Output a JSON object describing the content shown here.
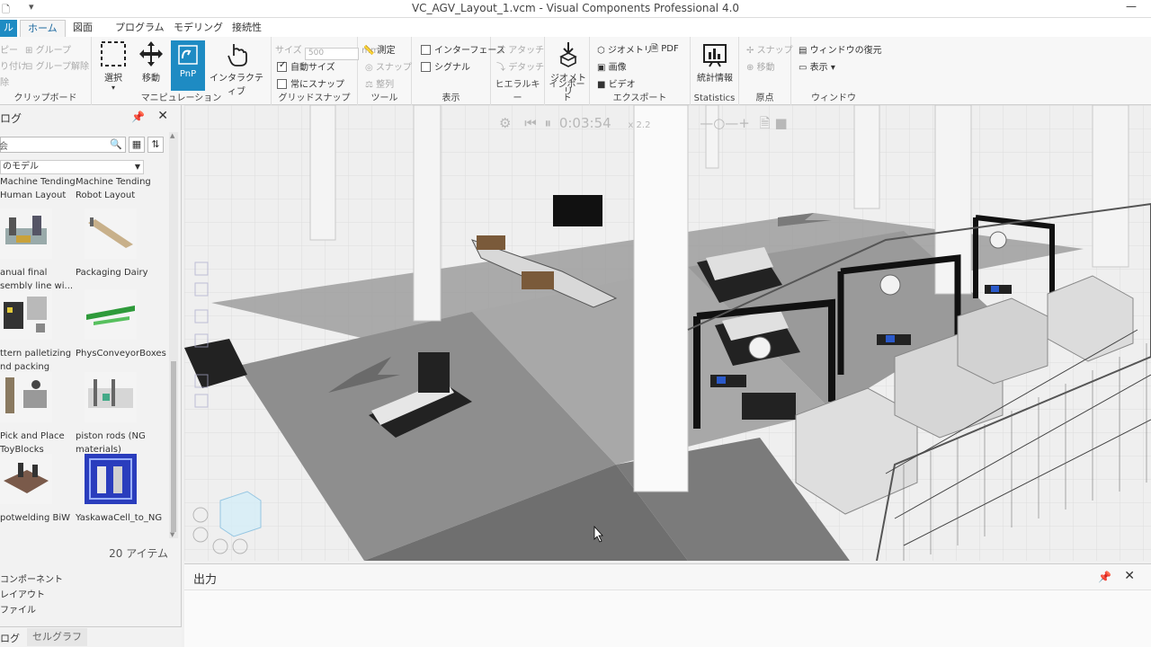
{
  "window": {
    "title": "VC_AGV_Layout_1.vcm - Visual Components Professional 4.0",
    "qa_icon": "file-icon",
    "qa_arrow": "▾",
    "minimize": "—"
  },
  "tabs": {
    "file": "ル",
    "home": "ホーム",
    "drawing": "図面",
    "program": "プログラム",
    "modeling": "モデリング",
    "connectivity": "接続性"
  },
  "ribbon": {
    "clipboard": {
      "label": "クリップボード",
      "items": [
        "ピー",
        "り付け",
        "除"
      ],
      "group": "グループ",
      "ungroup": "グループ解除"
    },
    "manipulation": {
      "label": "マニピュレーション",
      "select": "選択",
      "move": "移動",
      "pnp": "PnP",
      "interactive": "インタラクティブ"
    },
    "grid_snap": {
      "label": "グリッドスナップ",
      "size_label": "サイズ",
      "size_value": "500",
      "size_unit": "mm",
      "auto_size": "自動サイズ",
      "always_snap": "常にスナップ"
    },
    "tools": {
      "label": "ツール",
      "measure": "測定",
      "snap": "スナップ",
      "align": "整列"
    },
    "display": {
      "label": "表示",
      "interface": "インターフェース",
      "signal": "シグナル"
    },
    "hierarchy": {
      "label": "ヒエラルキー",
      "attach": "アタッチ",
      "detach": "デタッチ"
    },
    "import": {
      "label": "インポート",
      "geometry": "ジオメトリ"
    },
    "export": {
      "label": "エクスポート",
      "geometry": "ジオメトリ",
      "pdf": "PDF",
      "image": "画像",
      "video": "ビデオ"
    },
    "statistics": {
      "label": "Statistics",
      "stats": "統計情報"
    },
    "origin": {
      "label": "原点",
      "snap": "スナップ",
      "move": "移動"
    },
    "window": {
      "label": "ウィンドウ",
      "restore": "ウィンドウの復元",
      "display": "表示 ▾"
    }
  },
  "catalog": {
    "title": "ログ",
    "search_placeholder": "会",
    "dropdown": "のモデル",
    "items": [
      {
        "label": "Machine Tending Human Layout"
      },
      {
        "label": "Machine Tending Robot Layout"
      },
      {
        "label": "anual final sembly line wi..."
      },
      {
        "label": "Packaging Dairy"
      },
      {
        "label": "ttern palletizing nd packing"
      },
      {
        "label": "PhysConveyorBoxes"
      },
      {
        "label": "Pick and Place ToyBlocks"
      },
      {
        "label": "piston rods (NG materials)"
      },
      {
        "label": "potwelding BiW"
      },
      {
        "label": "YaskawaCell_to_NG"
      }
    ],
    "count": "20 アイテム",
    "links": [
      "コンポーネント",
      "レイアウト",
      "ファイル"
    ],
    "bottom_tabs": [
      "ログ",
      "セルグラフ"
    ]
  },
  "viewport": {
    "sim_time": "0:03:54",
    "speed": "x 2.2"
  },
  "output": {
    "title": "出力"
  }
}
